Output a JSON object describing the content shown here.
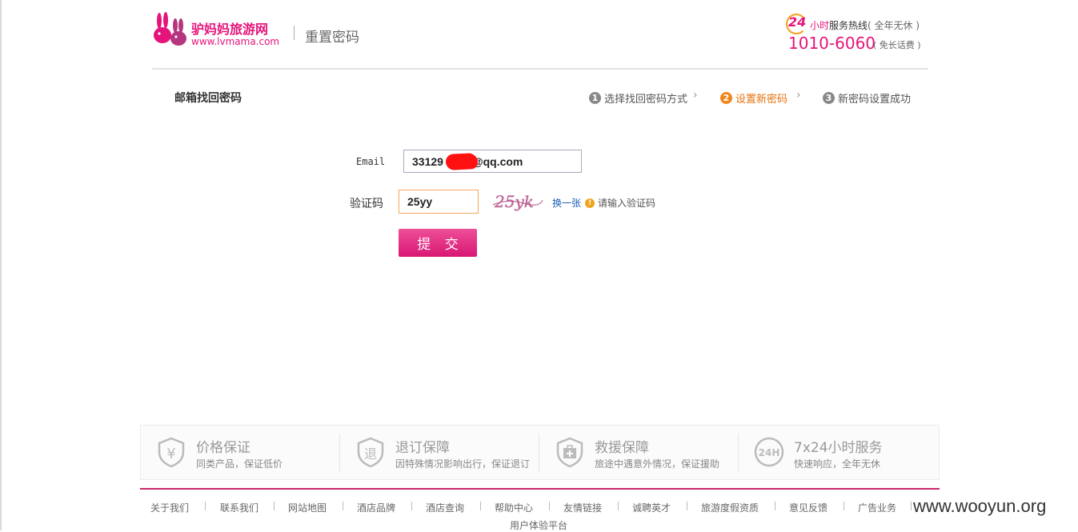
{
  "header": {
    "logo_cn": "驴妈妈旅游网",
    "logo_en": "www.lvmama.com",
    "page_title": "重置密码",
    "hotline_24": "24",
    "hotline_hours": "小时",
    "hotline_label": "服务热线",
    "hotline_allyear": "( 全年无休 )",
    "hotline_number": "1010-6060",
    "hotline_free": "( 免长话费 )"
  },
  "section_title": "邮箱找回密码",
  "steps": [
    {
      "num": "1",
      "label": "选择找回密码方式"
    },
    {
      "num": "2",
      "label": "设置新密码"
    },
    {
      "num": "3",
      "label": "新密码设置成功"
    }
  ],
  "form": {
    "email_label": "Email",
    "email_value_prefix": "33129",
    "email_value_suffix": "@qq.com",
    "code_label": "验证码",
    "code_value": "25yy",
    "captcha_text": "25yk",
    "refresh_label": "换一张",
    "hint_text": "请输入验证码",
    "submit_label": "提 交"
  },
  "guarantees": [
    {
      "title": "价格保证",
      "sub": "同类产品，保证低价",
      "icon": "yen-shield-icon"
    },
    {
      "title": "退订保障",
      "sub": "因特殊情况影响出行，保证退订",
      "icon": "refund-icon"
    },
    {
      "title": "救援保障",
      "sub": "旅途中遇意外情况，保证援助",
      "icon": "rescue-kit-icon"
    },
    {
      "title": "7x24小时服务",
      "sub": "快速响应，全年无休",
      "icon": "24h-icon",
      "badge": "24H"
    }
  ],
  "footer_links": [
    "关于我们",
    "联系我们",
    "网站地图",
    "酒店品牌",
    "酒店查询",
    "帮助中心",
    "友情链接",
    "诚聘英才",
    "旅游度假资质",
    "意见反馈",
    "广告业务",
    "用户体验平台"
  ],
  "watermark": "www.wooyun.org",
  "colors": {
    "brand": "#e5147a",
    "active_step": "#f08519",
    "link": "#1a5fb4"
  }
}
